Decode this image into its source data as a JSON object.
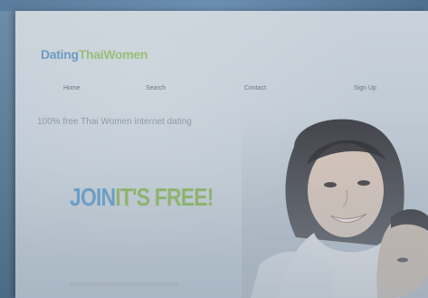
{
  "site": {
    "logo_part1": "Dating",
    "logo_part2": "ThaiWomen",
    "tagline": "100% free Thai Women internet dating"
  },
  "nav": {
    "items": [
      {
        "label": "Home"
      },
      {
        "label": "Search"
      },
      {
        "label": "Contact"
      },
      {
        "label": "Sign Up"
      }
    ]
  },
  "hero": {
    "join_label": "JOIN",
    "free_label": "IT'S FREE!"
  },
  "colors": {
    "logo_blue": "#6e9bc2",
    "logo_green": "#9bbd7a",
    "join_blue": "#6d9ec6",
    "free_green": "#8fb36f"
  }
}
